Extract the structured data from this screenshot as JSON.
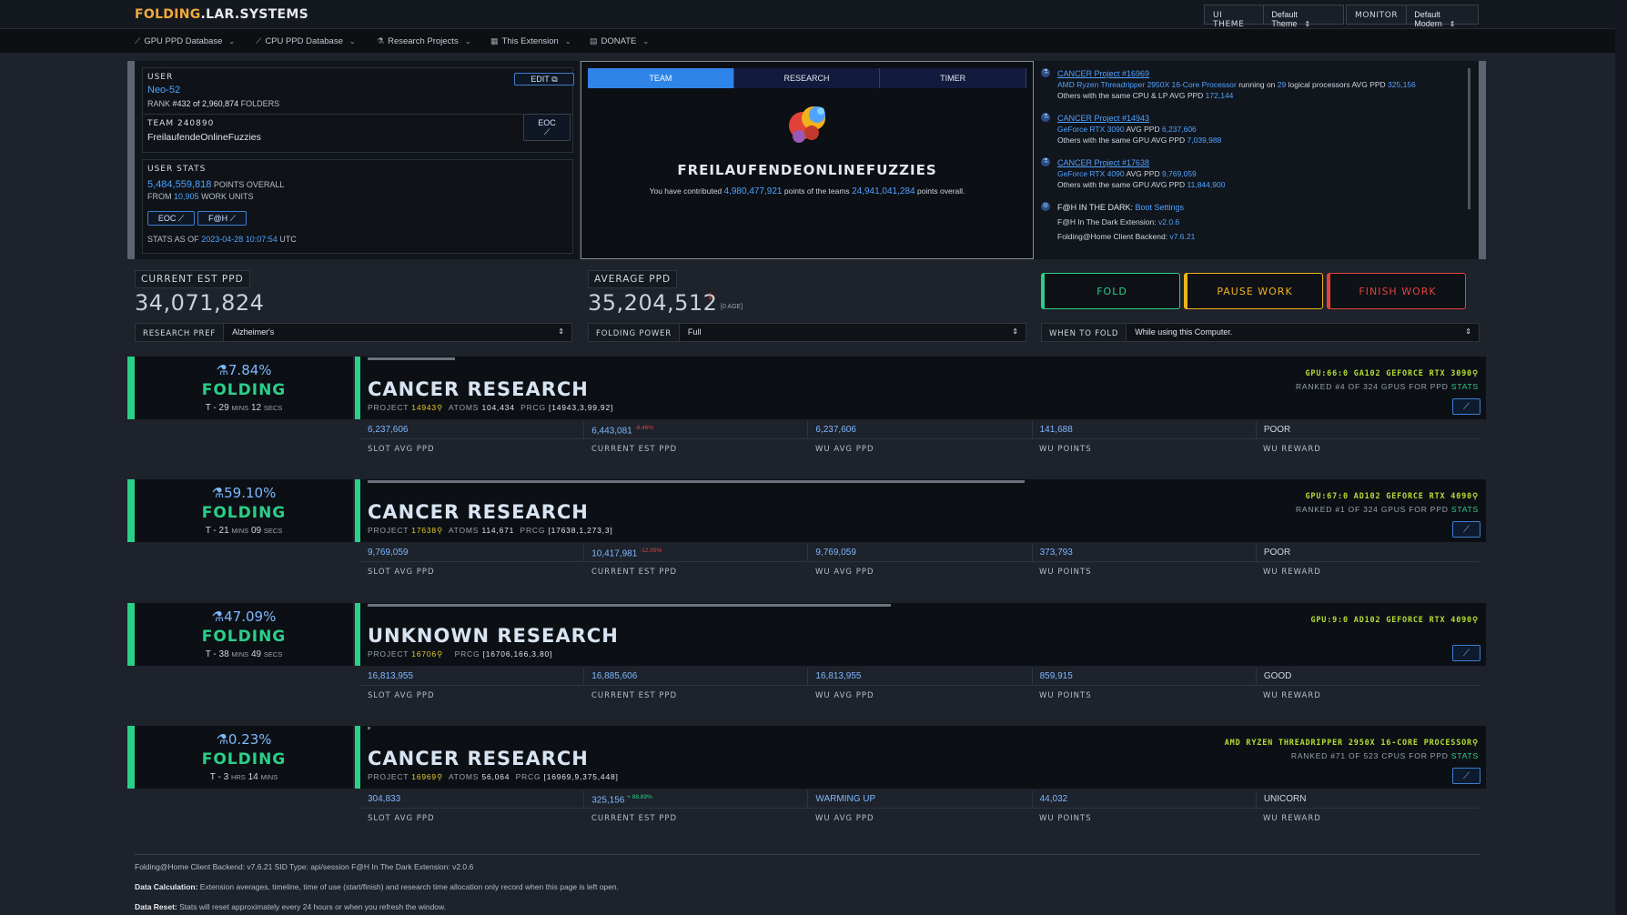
{
  "brand": {
    "part1": "FOLDING",
    "part2": ".LAR.SYSTEMS"
  },
  "topbar": {
    "ui_theme_label": "UI THEME",
    "ui_theme_value": "Default Theme",
    "monitor_label": "MONITOR",
    "monitor_value": "Default Modern"
  },
  "nav": [
    "GPU PPD Database",
    "CPU PPD Database",
    "Research Projects",
    "This Extension",
    "DONATE"
  ],
  "user": {
    "label": "USER",
    "name": "Neo-52",
    "edit": "EDIT",
    "rank_prefix": "RANK",
    "rank": "#432 of 2,960,874",
    "rank_suffix": "FOLDERS",
    "team_label": "TEAM",
    "team_id": "240890",
    "team_name": "FreilaufendeOnlineFuzzies",
    "eoc": "EOC",
    "stats_label": "USER STATS",
    "points": "5,484,559,818",
    "points_suffix": "POINTS OVERALL",
    "from_prefix": "FROM",
    "work_units": "10,905",
    "wu_suffix": "WORK UNITS",
    "btn_eoc": "EOC",
    "btn_fah": "F@H",
    "stats_as_of_prefix": "STATS AS OF",
    "stats_as_of": "2023-04-28 10:07:54",
    "stats_as_of_suffix": "UTC"
  },
  "center": {
    "tabs": [
      "TEAM",
      "RESEARCH",
      "TIMER"
    ],
    "team_name": "FREILAUFENDEONLINEFUZZIES",
    "contrib_1": "You have contributed",
    "contrib_points": "4,980,477,921",
    "contrib_2": "points of the teams",
    "team_points": "24,941,041,284",
    "contrib_3": "points overall."
  },
  "info": [
    {
      "title": "CANCER Project #16969",
      "line1a": "AMD Ryzen Threadripper 2950X 16-Core Processor",
      "line1b": " running on ",
      "line1c": "29",
      "line1d": " logical processors AVG PPD ",
      "line1e": "325,156",
      "line2a": "Others with the same CPU & LP AVG PPD ",
      "line2b": "172,144"
    },
    {
      "title": "CANCER Project #14943",
      "line1a": "GeForce RTX 3090",
      "line1d": " AVG PPD ",
      "line1e": "6,237,606",
      "line2a": "Others with the same GPU AVG PPD ",
      "line2b": "7,039,988"
    },
    {
      "title": "CANCER Project #17638",
      "line1a": "GeForce RTX 4090",
      "line1d": " AVG PPD ",
      "line1e": "9,769,059",
      "line2a": "Others with the same GPU AVG PPD ",
      "line2b": "11,844,900"
    },
    {
      "title_prefix": "F@H IN THE DARK:",
      "title": "Boot Settings",
      "line1a": "F@H In The Dark Extension: ",
      "line1e": "v2.0.6",
      "line2a": "Folding@Home Client Backend: ",
      "line2b": "v7.6.21"
    }
  ],
  "summary": {
    "current_label": "CURRENT EST PPD",
    "current_value": "34,071,824",
    "average_label": "AVERAGE PPD",
    "average_value": "35,204,512",
    "age": "[0 AGE]",
    "fold": "FOLD",
    "pause": "PAUSE WORK",
    "finish": "FINISH WORK",
    "research_pref_label": "RESEARCH PREF",
    "research_pref_value": "Alzheimer's",
    "folding_power_label": "FOLDING POWER",
    "folding_power_value": "Full",
    "when_label": "WHEN TO FOLD",
    "when_value": "While using this Computer.",
    "colors": {
      "fold": "#2bcf88",
      "pause": "#f2b21b",
      "finish": "#e2423a"
    }
  },
  "slots": [
    {
      "pct": "7.84%",
      "state": "FOLDING",
      "eta_prefix": "T -",
      "eta_a": "29",
      "eta_a_unit": "MINS",
      "eta_b": "12",
      "eta_b_unit": "SECS",
      "progress": 0.0784,
      "title": "CANCER RESEARCH",
      "project_label": "PROJECT",
      "project": "14943",
      "atoms_label": "ATOMS",
      "atoms": "104,434",
      "prcg_label": "PRCG",
      "prcg": "[14943,3,99,92]",
      "gpu": "GPU:66:0 GA102 GEFORCE RTX 3090",
      "rank": "RANKED #4 OF 324 GPUS FOR PPD",
      "stats": "STATS",
      "slot_ppd": "6,237,606",
      "current_ppd": "6,443,081",
      "current_delta": "-8.46%",
      "wu_avg": "6,237,606",
      "wu_points": "141,688",
      "wu_reward": "POOR"
    },
    {
      "pct": "59.10%",
      "state": "FOLDING",
      "eta_prefix": "T -",
      "eta_a": "21",
      "eta_a_unit": "MINS",
      "eta_b": "09",
      "eta_b_unit": "SECS",
      "progress": 0.591,
      "title": "CANCER RESEARCH",
      "project_label": "PROJECT",
      "project": "17638",
      "atoms_label": "ATOMS",
      "atoms": "114,671",
      "prcg_label": "PRCG",
      "prcg": "[17638,1,273,3]",
      "gpu": "GPU:67:0 AD102 GEFORCE RTX 4090",
      "rank": "RANKED #1 OF 324 GPUS FOR PPD",
      "stats": "STATS",
      "slot_ppd": "9,769,059",
      "current_ppd": "10,417,981",
      "current_delta": "-12.05%",
      "wu_avg": "9,769,059",
      "wu_points": "373,793",
      "wu_reward": "POOR"
    },
    {
      "pct": "47.09%",
      "state": "FOLDING",
      "eta_prefix": "T -",
      "eta_a": "38",
      "eta_a_unit": "MINS",
      "eta_b": "49",
      "eta_b_unit": "SECS",
      "progress": 0.4709,
      "title": "UNKNOWN RESEARCH",
      "project_label": "PROJECT",
      "project": "16706",
      "atoms_label": "",
      "atoms": "",
      "prcg_label": "PRCG",
      "prcg": "[16706,166,3,80]",
      "gpu": "GPU:9:0 AD102 GEFORCE RTX 4090",
      "rank": "",
      "stats": "",
      "slot_ppd": "16,813,955",
      "current_ppd": "16,885,606",
      "current_delta": "",
      "wu_avg": "16,813,955",
      "wu_points": "859,915",
      "wu_reward": "GOOD"
    },
    {
      "pct": "0.23%",
      "state": "FOLDING",
      "eta_prefix": "T -",
      "eta_a": "3",
      "eta_a_unit": "HRS",
      "eta_b": "14",
      "eta_b_unit": "MINS",
      "progress": 0.0023,
      "title": "CANCER RESEARCH",
      "project_label": "PROJECT",
      "project": "16969",
      "atoms_label": "ATOMS",
      "atoms": "56,064",
      "prcg_label": "PRCG",
      "prcg": "[16969,9,375,448]",
      "gpu": "AMD RYZEN THREADRIPPER 2950X 16-CORE PROCESSOR",
      "rank": "RANKED #71 OF 523 CPUS FOR PPD",
      "stats": "STATS",
      "slot_ppd": "304,833",
      "current_ppd": "325,156",
      "current_delta": "+ 88.89%",
      "wu_avg": "WARMING UP",
      "wu_points": "44,032",
      "wu_reward": "UNICORN"
    }
  ],
  "slot_labels": [
    "SLOT AVG PPD",
    "CURRENT EST PPD",
    "WU AVG PPD",
    "WU POINTS",
    "WU REWARD"
  ],
  "footer": {
    "line1": "Folding@Home Client Backend: v7.6.21   SID Type: api/session   F@H In The Dark Extension: v2.0.6",
    "calc_label": "Data Calculation:",
    "calc_text": " Extension averages, timeline, time of use (start/finish) and research time allocation only record when this page is left open.",
    "reset_label": "Data Reset:",
    "reset_text": " Stats will reset approximately every 24 hours or when you refresh the window."
  }
}
